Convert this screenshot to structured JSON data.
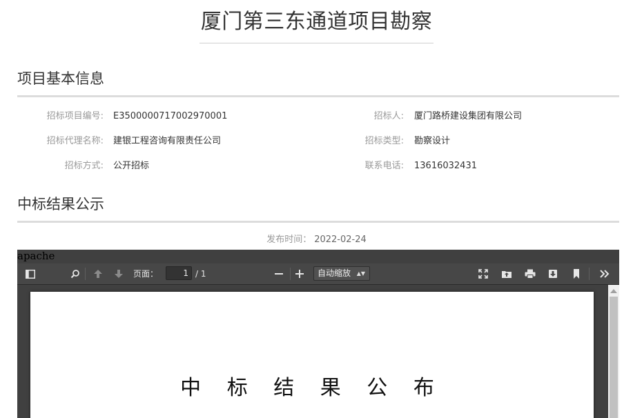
{
  "page": {
    "title": "厦门第三东通道项目勘察"
  },
  "project_info": {
    "section_title": "项目基本信息",
    "fields": [
      {
        "label": "招标项目编号:",
        "value": "E3500000717002970001"
      },
      {
        "label": "招标人:",
        "value": "厦门路桥建设集团有限公司"
      },
      {
        "label": "招标代理名称:",
        "value": "建银工程咨询有限责任公司"
      },
      {
        "label": "招标类型:",
        "value": "勘察设计"
      },
      {
        "label": "招标方式:",
        "value": "公开招标"
      },
      {
        "label": "联系电话:",
        "value": "13616032431"
      }
    ]
  },
  "result": {
    "section_title": "中标结果公示",
    "publish_label": "发布时间：",
    "publish_date": "2022-02-24"
  },
  "viewer": {
    "broken_text": "apache",
    "page_label": "页面：",
    "page_current": "1",
    "page_total": "/ 1",
    "zoom_value": "自动缩放",
    "icons": {
      "sidebar": "sidebar-toggle-icon",
      "find": "search-icon",
      "previous": "arrow-up-icon",
      "next": "arrow-down-icon",
      "zoom_out": "minus-icon",
      "zoom_in": "plus-icon",
      "presentation": "fullscreen-icon",
      "open": "open-file-icon",
      "print": "print-icon",
      "download": "download-icon",
      "bookmark": "bookmark-icon",
      "tools": "double-chevron-right-icon"
    },
    "document_heading": "中 标 结 果 公 布"
  },
  "colors": {
    "toolbar_bg": "#474747",
    "viewer_bg": "#404040",
    "rule": "#dcdcdc",
    "label": "#999999"
  }
}
